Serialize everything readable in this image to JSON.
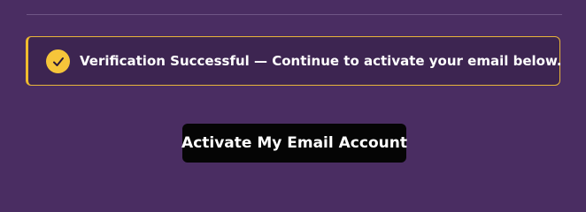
{
  "alert": {
    "icon": "check-circle-icon",
    "message": "Verification Successful — Continue to activate your email below.",
    "accent_color": "#f6c53a"
  },
  "action": {
    "button_label": "Activate My Email Account"
  },
  "colors": {
    "background": "#4a2d62",
    "alert_background": "#3d2551",
    "button_background": "#050505"
  }
}
